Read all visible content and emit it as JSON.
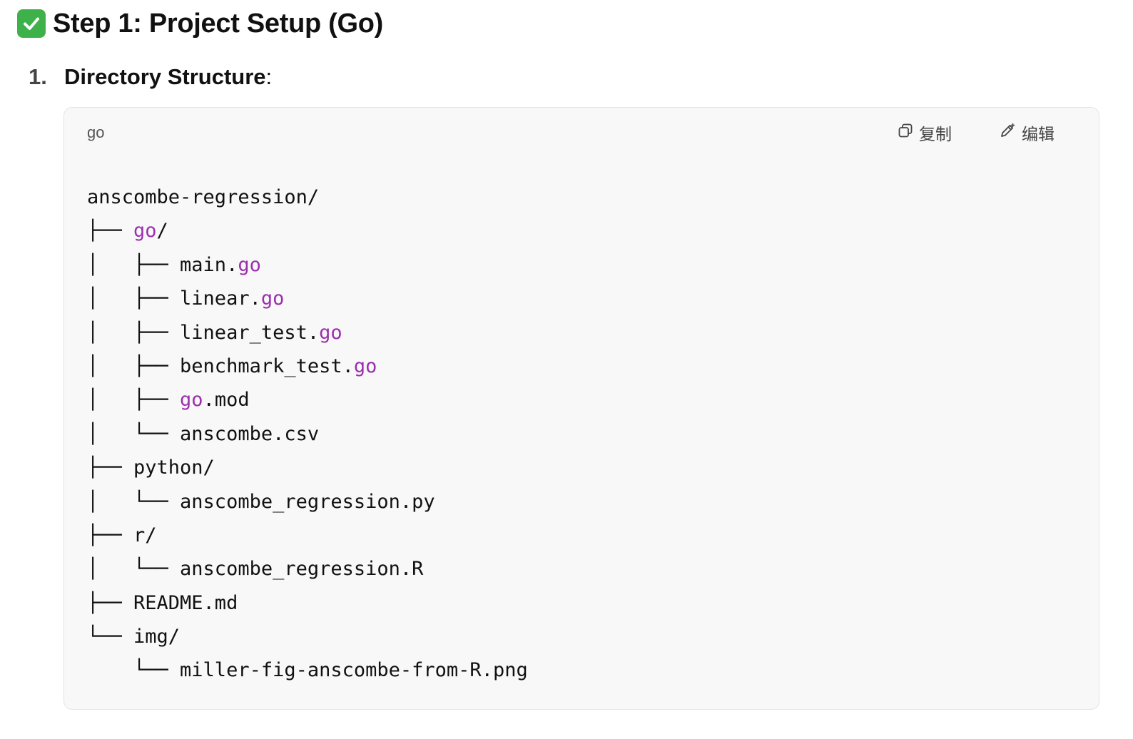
{
  "heading": {
    "icon": "white-heavy-check-mark-icon",
    "text": "Step 1: Project Setup (Go)"
  },
  "list": {
    "number": "1.",
    "title": "Directory Structure",
    "suffix": ":"
  },
  "code_block": {
    "language": "go",
    "copy_label": "复制",
    "edit_label": "编辑",
    "lines": [
      [
        {
          "t": "anscombe-regression/"
        }
      ],
      [
        {
          "t": "├── "
        },
        {
          "t": "go",
          "k": 1
        },
        {
          "t": "/"
        }
      ],
      [
        {
          "t": "│   ├── main."
        },
        {
          "t": "go",
          "k": 1
        }
      ],
      [
        {
          "t": "│   ├── linear."
        },
        {
          "t": "go",
          "k": 1
        }
      ],
      [
        {
          "t": "│   ├── linear_test."
        },
        {
          "t": "go",
          "k": 1
        }
      ],
      [
        {
          "t": "│   ├── benchmark_test."
        },
        {
          "t": "go",
          "k": 1
        }
      ],
      [
        {
          "t": "│   ├── "
        },
        {
          "t": "go",
          "k": 1
        },
        {
          "t": ".mod"
        }
      ],
      [
        {
          "t": "│   └── anscombe.csv"
        }
      ],
      [
        {
          "t": "├── python/"
        }
      ],
      [
        {
          "t": "│   └── anscombe_regression.py"
        }
      ],
      [
        {
          "t": "├── r/"
        }
      ],
      [
        {
          "t": "│   └── anscombe_regression.R"
        }
      ],
      [
        {
          "t": "├── README.md"
        }
      ],
      [
        {
          "t": "└── img/"
        }
      ],
      [
        {
          "t": "    └── miller-fig-anscombe-from-R.png"
        }
      ]
    ]
  },
  "colors": {
    "keyword": "#9b2fae",
    "check_icon_bg": "#3fb14a",
    "code_bg": "#f8f8f8"
  }
}
